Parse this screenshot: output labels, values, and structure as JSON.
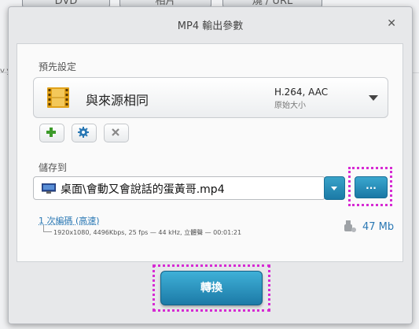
{
  "background": {
    "tabs": [
      "DVD",
      "相片",
      "燒 / URL"
    ],
    "side_fragment": "v.y"
  },
  "dialog": {
    "title": "MP4 輸出參數",
    "close_icon": "close-icon"
  },
  "preset": {
    "section_label": "預先設定",
    "name": "與來源相同",
    "codec": "H.264, AAC",
    "size_note": "原始大小",
    "icon": "film-icon",
    "buttons": [
      "add-icon",
      "gear-icon",
      "remove-icon"
    ]
  },
  "save": {
    "section_label": "儲存到",
    "path": "桌面\\會動又會說話的蛋黃哥.mp4",
    "browse_label": "..."
  },
  "encoding": {
    "link": "1 次編碼 (高速)",
    "details": "1920x1080, 4496Kbps, 25 fps — 44 kHz, 立體聲 — 00:01:21",
    "size": "47 Mb"
  },
  "convert_label": "轉換",
  "colors": {
    "accent": "#1c7aa7",
    "highlight_dotted": "#d62bd3",
    "link": "#2a78b4"
  }
}
